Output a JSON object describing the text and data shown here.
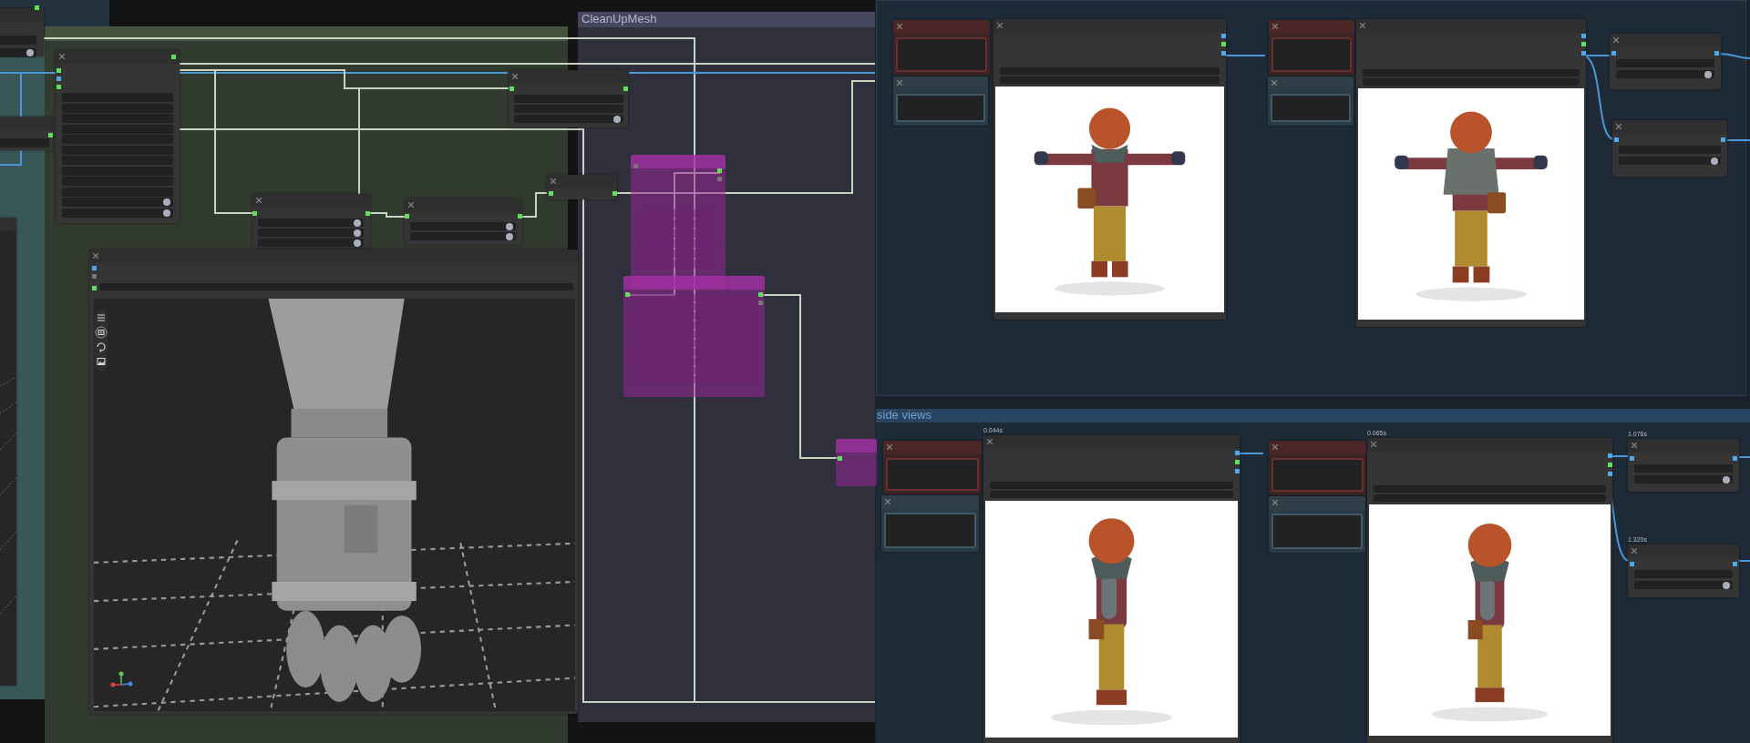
{
  "groups": [
    {
      "title": "CleanUpMesh"
    },
    {
      "title": "side views"
    }
  ],
  "node_timings": [
    {
      "text": "0.044s"
    },
    {
      "text": "0.065s"
    },
    {
      "text": "1.076s"
    },
    {
      "text": "1.320s"
    }
  ]
}
